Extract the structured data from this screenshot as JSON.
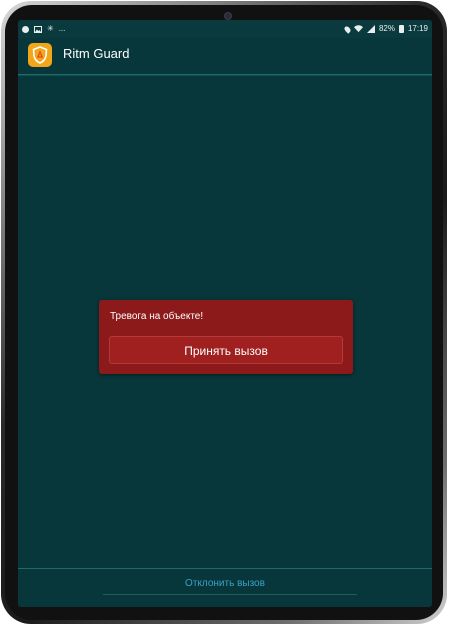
{
  "statusbar": {
    "left_more": "...",
    "battery_percent": "82%",
    "time": "17:19"
  },
  "appbar": {
    "title": "Ritm Guard"
  },
  "alarm_dialog": {
    "message": "Тревога на объекте!",
    "accept_label": "Принять вызов"
  },
  "footer": {
    "reject_label": "Отклонить вызов"
  },
  "colors": {
    "screen_bg": "#07373a",
    "dialog_bg": "#8c1a1a",
    "accept_bg": "#a01f1f",
    "logo_bg": "#f2a61a",
    "link_color": "#3aa0c8"
  },
  "icons": {
    "status_left": [
      "notification-icon",
      "image-icon",
      "sync-icon"
    ],
    "status_right": [
      "location-icon",
      "wifi-icon",
      "signal-icon",
      "battery-icon"
    ],
    "app_logo": "shield-icon"
  }
}
